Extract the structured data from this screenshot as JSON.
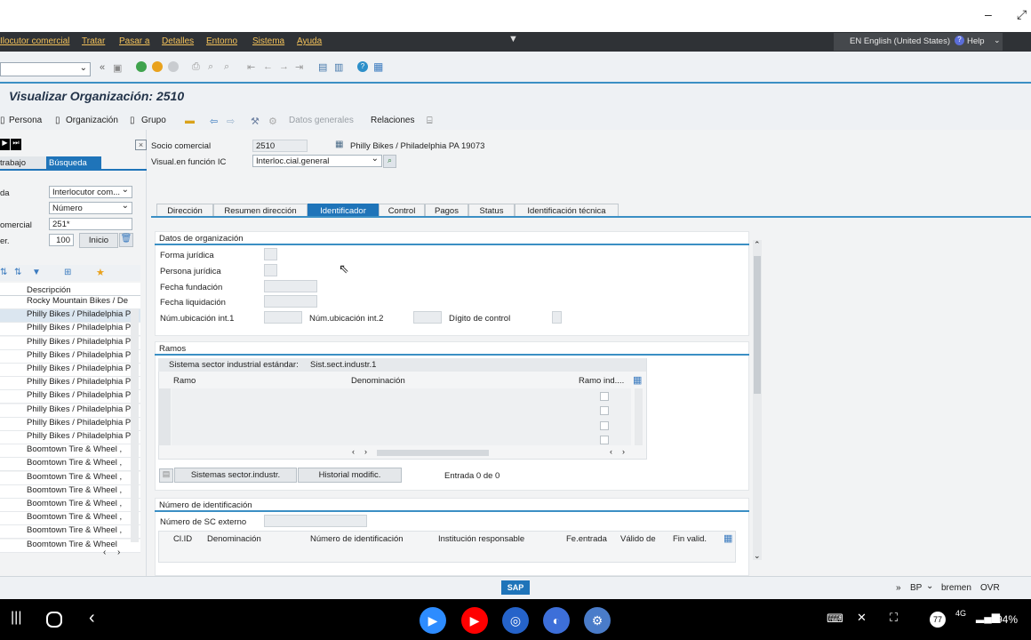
{
  "menu": [
    "Interlocutor comercial",
    "Tratar",
    "Pasar a",
    "Detalles",
    "Entorno",
    "Sistema",
    "Ayuda"
  ],
  "menu_display": [
    "Ilocutor comercial",
    "Tratar",
    "Pasar a",
    "Detalles",
    "Entorno",
    "Sistema",
    "Ayuda"
  ],
  "lang": "EN English (United States)",
  "help": "Help",
  "title": "Visualizar Organización: 2510",
  "toolbar2": {
    "persona": "Persona",
    "organizacion": "Organización",
    "grupo": "Grupo",
    "datos_generales": "Datos generales",
    "relaciones": "Relaciones"
  },
  "left": {
    "tab_trabajo": "trabajo",
    "tab_busqueda": "Búsqueda",
    "row1_label": "da",
    "row1_value": "Interlocutor com...",
    "row2_value": "Número",
    "row3_label": "omercial",
    "row3_value": "251*",
    "row4_label": "er.",
    "row4_value": "100",
    "inicio": "Inicio",
    "list_header": "Descripción",
    "items": [
      "Rocky Mountain Bikes / De",
      "Philly Bikes / Philadelphia P",
      "Philly Bikes / Philadelphia P",
      "Philly Bikes / Philadelphia P",
      "Philly Bikes / Philadelphia P",
      "Philly Bikes / Philadelphia P",
      "Philly Bikes / Philadelphia P",
      "Philly Bikes / Philadelphia P",
      "Philly Bikes / Philadelphia P",
      "Philly Bikes / Philadelphia P",
      "Philly Bikes / Philadelphia P",
      "Boomtown Tire & Wheel ,",
      "Boomtown Tire & Wheel ,",
      "Boomtown Tire & Wheel ,",
      "Boomtown Tire & Wheel ,",
      "Boomtown Tire & Wheel ,",
      "Boomtown Tire & Wheel ,",
      "Boomtown Tire & Wheel ,",
      "Boomtown Tire & Wheel"
    ]
  },
  "header": {
    "socio_label": "Socio comercial",
    "socio_value": "2510",
    "socio_desc": "Philly Bikes / Philadelphia PA 19073",
    "visual_label": "Visual.en función IC",
    "visual_value": "Interloc.cial.general"
  },
  "tabs": [
    "Dirección",
    "Resumen dirección",
    "Identificador",
    "Control",
    "Pagos",
    "Status",
    "Identificación técnica"
  ],
  "active_tab": "Identificador",
  "org": {
    "title": "Datos de organización",
    "forma": "Forma jurídica",
    "persona": "Persona jurídica",
    "fundacion": "Fecha fundación",
    "liquidacion": "Fecha liquidación",
    "ubic1": "Núm.ubicación int.1",
    "ubic2": "Núm.ubicación int.2",
    "digito": "Dígito de control"
  },
  "ramos": {
    "title": "Ramos",
    "sistema_label": "Sistema sector industrial estándar:",
    "sistema_value": "Sist.sect.industr.1",
    "col_ramo": "Ramo",
    "col_denominacion": "Denominación",
    "col_ramo_ind": "Ramo ind....",
    "btn_sistemas": "Sistemas sector.industr.",
    "btn_historial": "Historial modific.",
    "entrada": "Entrada 0 de 0"
  },
  "ident": {
    "title": "Número de identificación",
    "externo": "Número de SC externo",
    "cols": [
      "Cl.ID",
      "Denominación",
      "Número de identificación",
      "Institución responsable",
      "Fe.entrada",
      "Válido de",
      "Fin valid."
    ]
  },
  "status": {
    "bp": "BP",
    "server": "bremen",
    "mode": "OVR",
    "logo": "SAP"
  },
  "android": {
    "battery": "94%",
    "net": "4G",
    "notif": "77"
  },
  "colors": {
    "accent": "#1f74b9",
    "menubar": "#2f3236",
    "menu_text": "#f2c15a"
  }
}
